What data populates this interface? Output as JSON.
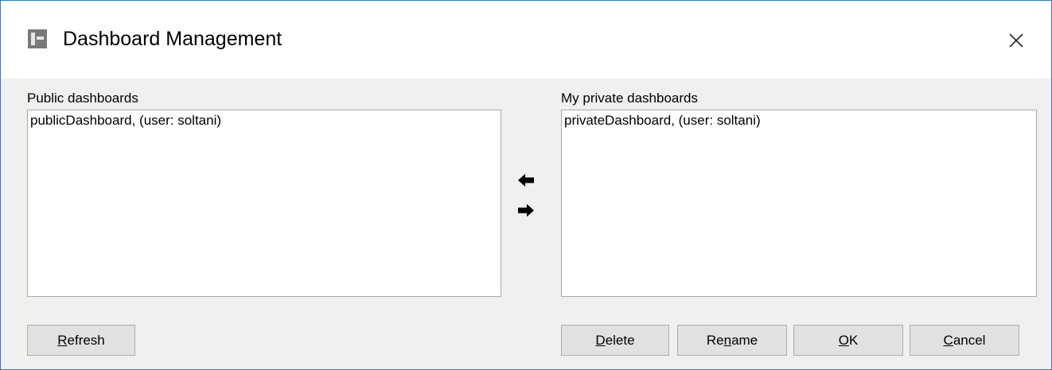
{
  "window": {
    "title": "Dashboard Management",
    "accent_color": "#2b79c2"
  },
  "icons": {
    "app": "dashboard-app-icon",
    "close": "close-icon",
    "move_left": "arrow-left-icon",
    "move_right": "arrow-right-icon"
  },
  "public_panel": {
    "label": "Public dashboards",
    "items": [
      "publicDashboard, (user: soltani)"
    ]
  },
  "private_panel": {
    "label": "My private dashboards",
    "items": [
      "privateDashboard, (user: soltani)"
    ]
  },
  "buttons": {
    "refresh": {
      "pre": "",
      "mnemonic": "R",
      "post": "efresh"
    },
    "delete": {
      "pre": "",
      "mnemonic": "D",
      "post": "elete"
    },
    "rename": {
      "pre": "Re",
      "mnemonic": "n",
      "post": "ame"
    },
    "ok": {
      "pre": "",
      "mnemonic": "O",
      "post": "K"
    },
    "cancel": {
      "pre": "",
      "mnemonic": "C",
      "post": "ancel"
    }
  }
}
